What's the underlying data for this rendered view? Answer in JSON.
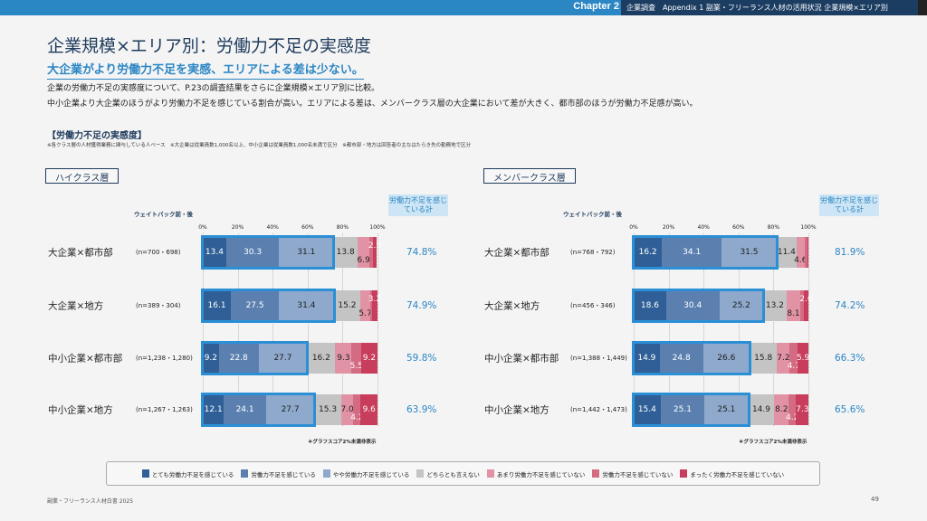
{
  "header": {
    "chapter": "Chapter 2",
    "breadcrumb": "企業調査　Appendix 1 副業・フリーランス人材の活用状況 企業規模×エリア別"
  },
  "title": "企業規模×エリア別：労働力不足の実感度",
  "subtitle": "大企業がより労働力不足を実感、エリアによる差は少ない。",
  "body": [
    "企業の労働力不足の実感度について、P.23の調査結果をさらに企業規模×エリア別に比較。",
    "中小企業より大企業のほうがより労働力不足を感じている割合が高い。エリアによる差は、メンバークラス層の大企業において差が大きく、都市部のほうが労働力不足感が高い。"
  ],
  "section_title": "【労働力不足の実感度】",
  "notes": "※各クラス層の人材獲得業務に関与している人ベース　※大企業は従業員数1,000名以上、中小企業は従業員数1,000名未満で区分　※都市部・地方は回答者の主なはたらき先の勤務地で区分",
  "footer": {
    "left": "副業・フリーランス人材白書 2025",
    "page": "49"
  },
  "chart_data": [
    {
      "type": "bar",
      "stacked": true,
      "orientation": "horizontal",
      "title": "ハイクラス層",
      "weight_label": "ウェイトバック前・後",
      "total_header": "労働力不足を感じている計",
      "xlim": [
        0,
        100
      ],
      "ticks": [
        "0%",
        "20%",
        "40%",
        "60%",
        "80%",
        "100%"
      ],
      "footnote": "＊グラフスコア2%未満非表示",
      "rows": [
        {
          "label": "大企業×都市部",
          "n": "(n=700・698)",
          "values": [
            13.4,
            30.3,
            31.1,
            13.8,
            6.9,
            1.7,
            2.5
          ],
          "total": "74.8%"
        },
        {
          "label": "大企業×地方",
          "n": "(n=389・304)",
          "values": [
            16.1,
            27.5,
            31.4,
            15.2,
            5.7,
            0.9,
            3.2
          ],
          "total": "74.9%"
        },
        {
          "label": "中小企業×都市部",
          "n": "(n=1,238・1,280)",
          "values": [
            9.2,
            22.8,
            27.7,
            16.2,
            9.3,
            5.5,
            9.2
          ],
          "total": "59.8%"
        },
        {
          "label": "中小企業×地方",
          "n": "(n=1,267・1,263)",
          "values": [
            12.1,
            24.1,
            27.7,
            15.3,
            7.0,
            4.2,
            9.6
          ],
          "total": "63.9%"
        }
      ]
    },
    {
      "type": "bar",
      "stacked": true,
      "orientation": "horizontal",
      "title": "メンバークラス層",
      "weight_label": "ウェイトバック前・後",
      "total_header": "労働力不足を感じている計",
      "xlim": [
        0,
        100
      ],
      "ticks": [
        "0%",
        "20%",
        "40%",
        "60%",
        "80%",
        "100%"
      ],
      "footnote": "＊グラフスコア2%未満非表示",
      "rows": [
        {
          "label": "大企業×都市部",
          "n": "(n=768・792)",
          "values": [
            16.2,
            34.1,
            31.5,
            11.4,
            4.6,
            1.5,
            0.7
          ],
          "total": "81.9%"
        },
        {
          "label": "大企業×地方",
          "n": "(n=456・346)",
          "values": [
            18.6,
            30.4,
            25.2,
            13.2,
            8.1,
            1.9,
            2.6
          ],
          "total": "74.2%"
        },
        {
          "label": "中小企業×都市部",
          "n": "(n=1,388・1,449)",
          "values": [
            14.9,
            24.8,
            26.6,
            15.8,
            7.2,
            4.7,
            5.9
          ],
          "total": "66.3%"
        },
        {
          "label": "中小企業×地方",
          "n": "(n=1,442・1,473)",
          "values": [
            15.4,
            25.1,
            25.1,
            14.9,
            8.2,
            4.2,
            7.3
          ],
          "total": "65.6%"
        }
      ]
    }
  ],
  "legend": [
    {
      "label": "とても労働力不足を感じている",
      "color": "#2f5f96"
    },
    {
      "label": "労働力不足を感じている",
      "color": "#5b80b0"
    },
    {
      "label": "やや労働力不足を感じている",
      "color": "#8ea9cc"
    },
    {
      "label": "どちらとも言えない",
      "color": "#c4c4c4"
    },
    {
      "label": "あまり労働力不足を感じていない",
      "color": "#e193a5"
    },
    {
      "label": "労働力不足を感じていない",
      "color": "#d36c83"
    },
    {
      "label": "まったく労働力不足を感じていない",
      "color": "#c83c5c"
    }
  ]
}
